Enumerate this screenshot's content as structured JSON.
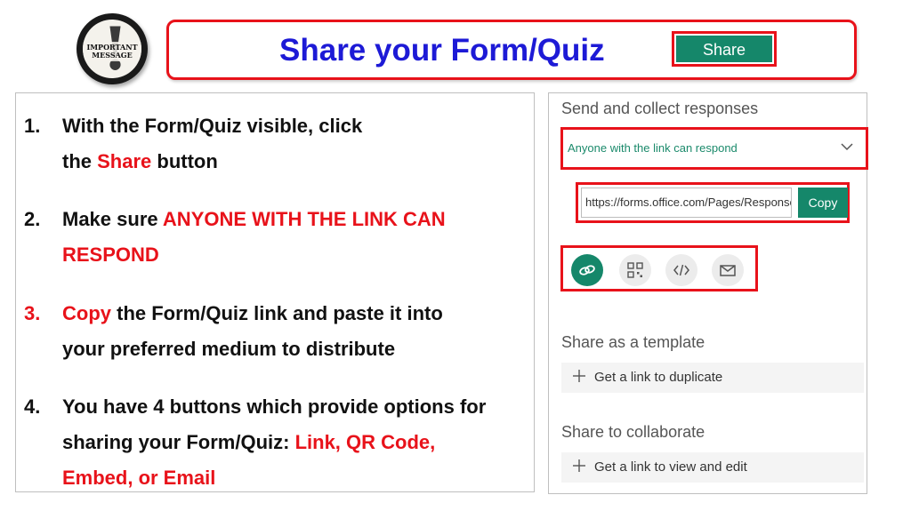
{
  "badge": {
    "line1": "IMPORTANT",
    "line2": "MESSAGE",
    "mark": "!"
  },
  "title": {
    "text": "Share your Form/Quiz",
    "share_button": "Share"
  },
  "steps": [
    {
      "num": "1.",
      "parts": [
        "With the Form/Quiz visible, click",
        "the ",
        "Share",
        " button"
      ]
    },
    {
      "num": "2.",
      "parts": [
        "Make sure ",
        "ANYONE WITH THE LINK CAN",
        "RESPOND"
      ]
    },
    {
      "num": "3.",
      "parts": [
        "Copy",
        " the Form/Quiz link and paste it  into",
        "your preferred medium to distribute"
      ]
    },
    {
      "num": "4.",
      "parts": [
        "You have 4 buttons which provide options for",
        "sharing your Form/Quiz: ",
        "Link, QR Code,",
        "Embed, or Email"
      ]
    }
  ],
  "panel": {
    "send_heading": "Send and collect responses",
    "dropdown_value": "Anyone with the link can respond",
    "link_value": "https://forms.office.com/Pages/ResponsePage",
    "copy_label": "Copy",
    "template_heading": "Share as a template",
    "template_action": "Get a link to duplicate",
    "collab_heading": "Share to collaborate",
    "collab_action": "Get a link to view and edit",
    "share_icons": [
      "link-icon",
      "qr-code-icon",
      "embed-icon",
      "email-icon"
    ]
  },
  "colors": {
    "accent": "#15876a",
    "title": "#1d1ad6",
    "highlight": "#e8121a"
  }
}
